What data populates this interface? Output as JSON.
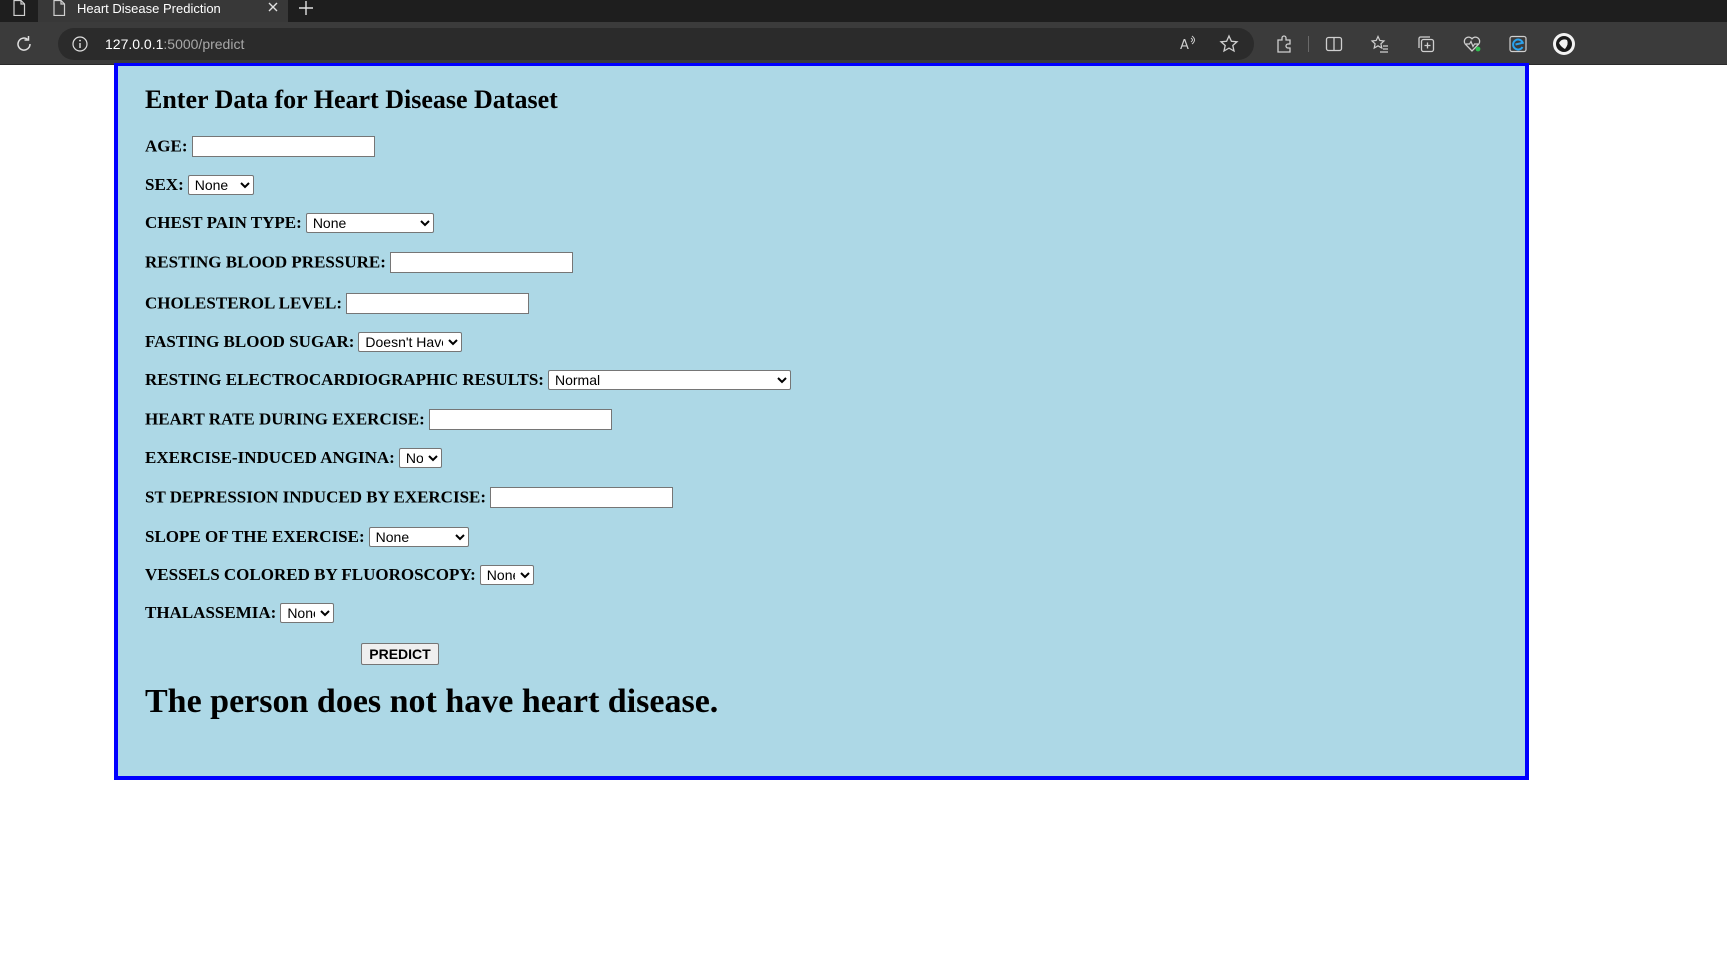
{
  "browser": {
    "tab_title": "Heart Disease Prediction",
    "url_host": "127.0.0.1",
    "url_rest": ":5000/predict"
  },
  "form": {
    "title": "Enter Data for Heart Disease Dataset",
    "age_label": "AGE:",
    "age_value": "",
    "sex_label": "SEX:",
    "sex_value": "None",
    "cp_label": "CHEST PAIN TYPE:",
    "cp_value": "None",
    "bp_label": "RESTING BLOOD PRESSURE:",
    "bp_value": "",
    "chol_label": "CHOLESTEROL LEVEL:",
    "chol_value": "",
    "fbs_label": "FASTING BLOOD SUGAR:",
    "fbs_value": "Doesn't Have",
    "ecg_label": "RESTING ELECTROCARDIOGRAPHIC RESULTS:",
    "ecg_value": "Normal",
    "hr_label": "HEART RATE DURING EXERCISE:",
    "hr_value": "",
    "angina_label": "EXERCISE-INDUCED ANGINA:",
    "angina_value": "No",
    "st_label": "ST DEPRESSION INDUCED BY EXERCISE:",
    "st_value": "",
    "slope_label": "SLOPE OF THE EXERCISE:",
    "slope_value": "None",
    "vessels_label": "VESSELS COLORED BY FLUOROSCOPY:",
    "vessels_value": "None",
    "thal_label": "THALASSEMIA:",
    "thal_value": "None",
    "predict_label": "PREDICT"
  },
  "result": {
    "text": "The person does not have heart disease."
  },
  "icons": [
    "page-icon",
    "close-icon",
    "plus-icon",
    "reload-icon",
    "info-icon",
    "read-aloud-icon",
    "favorite-star-icon",
    "extensions-icon",
    "split-screen-icon",
    "favorites-icon",
    "collections-icon",
    "browser-essentials-icon",
    "edge-icon",
    "profile-icon"
  ],
  "colors": {
    "panel_bg": "#add8e6",
    "panel_border": "#0000ff"
  }
}
